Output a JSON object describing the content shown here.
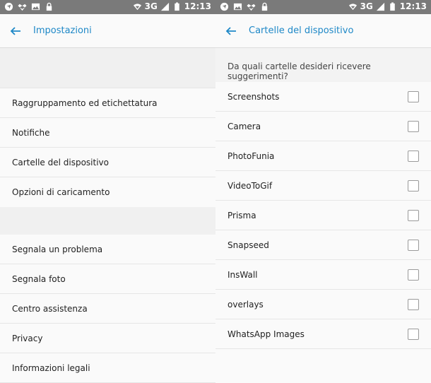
{
  "status_bar": {
    "network": "3G",
    "time": "12:13"
  },
  "settings": {
    "title": "Impostazioni",
    "group1": [
      "Raggruppamento ed etichettatura",
      "Notifiche",
      "Cartelle del dispositivo",
      "Opzioni di caricamento"
    ],
    "group2": [
      "Segnala un problema",
      "Segnala foto",
      "Centro assistenza",
      "Privacy",
      "Informazioni legali"
    ]
  },
  "folders": {
    "title": "Cartelle del dispositivo",
    "question": "Da quali cartelle desideri ricevere suggerimenti?",
    "items": [
      {
        "label": "Screenshots",
        "checked": false
      },
      {
        "label": "Camera",
        "checked": false
      },
      {
        "label": "PhotoFunia",
        "checked": false
      },
      {
        "label": "VideoToGif",
        "checked": false
      },
      {
        "label": "Prisma",
        "checked": false
      },
      {
        "label": "Snapseed",
        "checked": false
      },
      {
        "label": "InsWall",
        "checked": false
      },
      {
        "label": "overlays",
        "checked": false
      },
      {
        "label": "WhatsApp Images",
        "checked": false
      }
    ]
  },
  "icons": {
    "status_left": [
      "location-icon",
      "dropbox-icon",
      "image-icon",
      "lock-icon"
    ],
    "status_right": [
      "wifi-icon",
      "signal-icon",
      "battery-icon"
    ],
    "appbar": "back-arrow-icon"
  },
  "colors": {
    "accent": "#1e88c7",
    "status_bar": "#7a7a7a"
  }
}
